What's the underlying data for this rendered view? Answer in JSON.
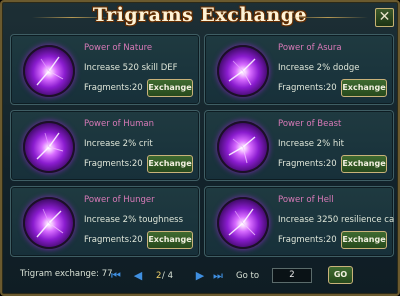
{
  "window": {
    "title": "Trigrams Exchange",
    "close_icon": "close-icon"
  },
  "cards": [
    {
      "name": "Power of Nature",
      "effect": "Increase 520 skill DEF",
      "fragments": "Fragments:20",
      "button": "Exchange"
    },
    {
      "name": "Power of Asura",
      "effect": "Increase 2% dodge",
      "fragments": "Fragments:20",
      "button": "Exchange"
    },
    {
      "name": "Power of Human",
      "effect": "Increase 2% crit",
      "fragments": "Fragments:20",
      "button": "Exchange"
    },
    {
      "name": "Power of Beast",
      "effect": "Increase 2% hit",
      "fragments": "Fragments:20",
      "button": "Exchange"
    },
    {
      "name": "Power of Hunger",
      "effect": "Increase 2% toughness",
      "fragments": "Fragments:20",
      "button": "Exchange"
    },
    {
      "name": "Power of Hell",
      "effect": "Increase 3250 resilience ca",
      "fragments": "Fragments:20",
      "button": "Exchange"
    }
  ],
  "footer": {
    "label": "Trigram exchange: 77",
    "page_current": "2",
    "page_rest": "/ 4",
    "goto_label": "Go to",
    "goto_value": "2",
    "go_button": "GO"
  },
  "colors": {
    "title": "#fff3d6",
    "power_name": "#d87ab8",
    "body_text": "#dfe6d9",
    "button_green": "#3f6a30",
    "button_border": "#c9b27a",
    "nav_blue": "#3f8fe0",
    "page_current": "#f1d36b"
  }
}
